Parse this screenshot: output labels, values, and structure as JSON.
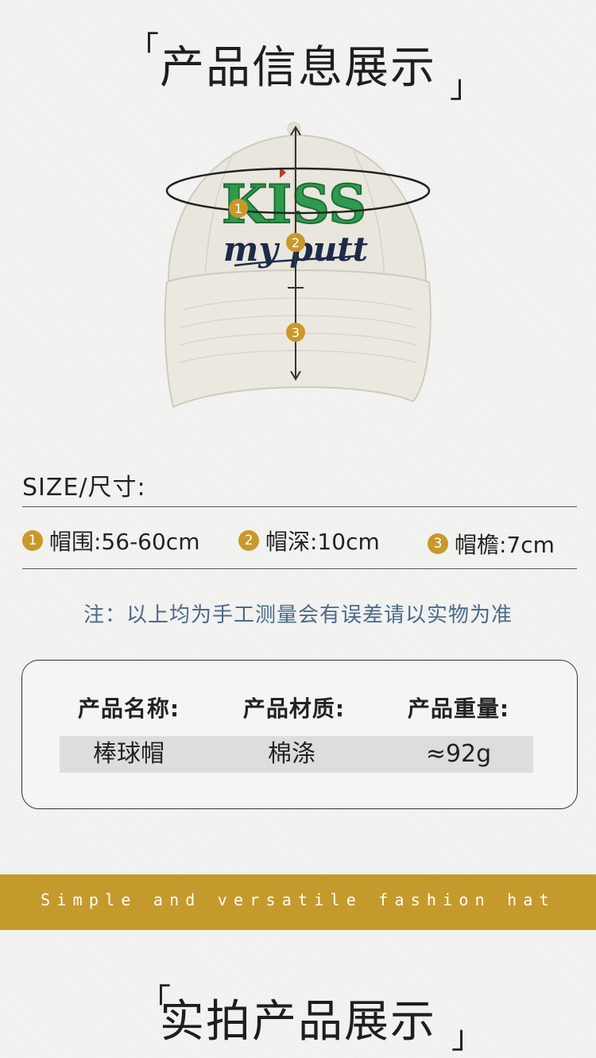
{
  "section1": {
    "title": "产品信息展示"
  },
  "hat": {
    "embroidery_main": "KISS",
    "embroidery_sub": "my putt",
    "markers": [
      "1",
      "2",
      "3"
    ]
  },
  "size": {
    "label": "SIZE/尺寸:",
    "items": [
      {
        "badge": "1",
        "text": "帽围:56-60cm"
      },
      {
        "badge": "2",
        "text": "帽深:10cm"
      },
      {
        "badge": "3",
        "text": "帽檐:7cm"
      }
    ],
    "note": "注：以上均为手工测量会有误差请以实物为准"
  },
  "info": {
    "headers": [
      "产品名称:",
      "产品材质:",
      "产品重量:"
    ],
    "values": [
      "棒球帽",
      "棉涤",
      "≈92g"
    ]
  },
  "band": {
    "text": "Simple and versatile fashion hat"
  },
  "section2": {
    "title": "实拍产品展示"
  },
  "colors": {
    "accent": "#c59a2c",
    "note": "#4a6a8a",
    "embroidery_green": "#2e9a4e",
    "embroidery_navy": "#1d2a4a"
  }
}
